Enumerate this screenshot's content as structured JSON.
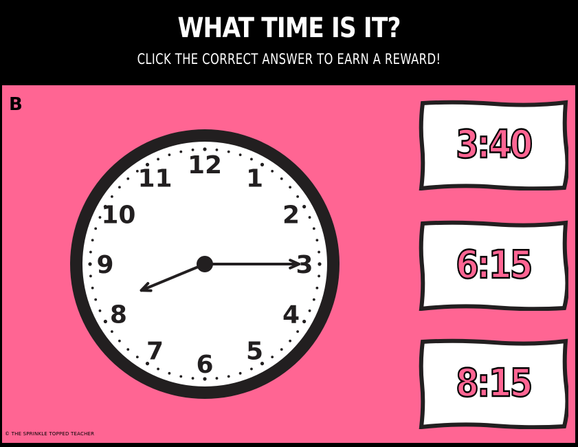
{
  "header": {
    "title": "WHAT TIME IS IT?",
    "subtitle": "CLICK THE CORRECT ANSWER TO EARN A REWARD!"
  },
  "card": {
    "version_letter": "B",
    "copyright": "© THE SPRINKLE TOPPED TEACHER"
  },
  "clock": {
    "numerals": [
      "12",
      "1",
      "2",
      "3",
      "4",
      "5",
      "6",
      "7",
      "8",
      "9",
      "10",
      "11"
    ],
    "hour_hand_time": 8.25,
    "minute_hand_minutes": 15
  },
  "answers": [
    {
      "label": "3:40"
    },
    {
      "label": "6:15"
    },
    {
      "label": "8:15"
    }
  ],
  "colors": {
    "background": "#000000",
    "board": "#ff6593",
    "accent_text": "#ff6593",
    "card_fill": "#ffffff"
  }
}
